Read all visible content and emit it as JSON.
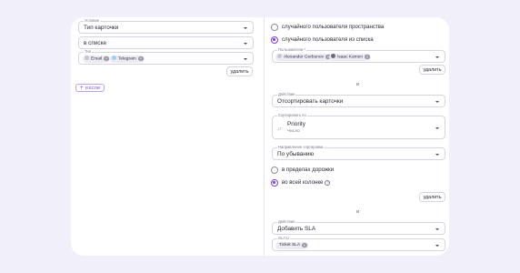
{
  "left": {
    "condition": {
      "label": "Условие",
      "value": "Тип карточки"
    },
    "operator": {
      "value": "в списке"
    },
    "type_field": {
      "label": "Тип",
      "chips": [
        "Email",
        "Telegram"
      ]
    },
    "delete_label": "удалить",
    "add_if_label": "И ЕСЛИ"
  },
  "right": {
    "radio_space_user": "случайного пользователя пространства",
    "radio_list_user": "случайного пользователя из списка",
    "users_field": {
      "label": "Пользователи *",
      "chips": [
        "Alexander Gorbunov",
        "Isaac Kamen"
      ]
    },
    "delete_1": "удалить",
    "and_1": "и",
    "action_1": {
      "label": "Действие",
      "value": "Отсортировать карточки"
    },
    "sort_by": {
      "label": "Сортировать по",
      "value": "Priority",
      "sub": "Число"
    },
    "sort_dir": {
      "label": "Направление сортировки",
      "value": "По убыванию"
    },
    "radio_lane": "в пределах дорожки",
    "radio_column": "во всей колонке",
    "help_icon": "?",
    "delete_2": "удалить",
    "and_2": "и",
    "action_2": {
      "label": "Действие",
      "value": "Добавить SLA"
    },
    "sla_field": {
      "label": "SLA'ы",
      "chips": [
        "Ticket SLA"
      ]
    }
  },
  "colors": {
    "accent": "#7b3fe4",
    "background": "#f1effa",
    "card": "#ffffff"
  },
  "icons": {
    "caret": "chevron-down-icon",
    "chip_remove": "close-icon",
    "add": "plus-icon",
    "sort": "sort-icon",
    "help": "help-icon"
  }
}
